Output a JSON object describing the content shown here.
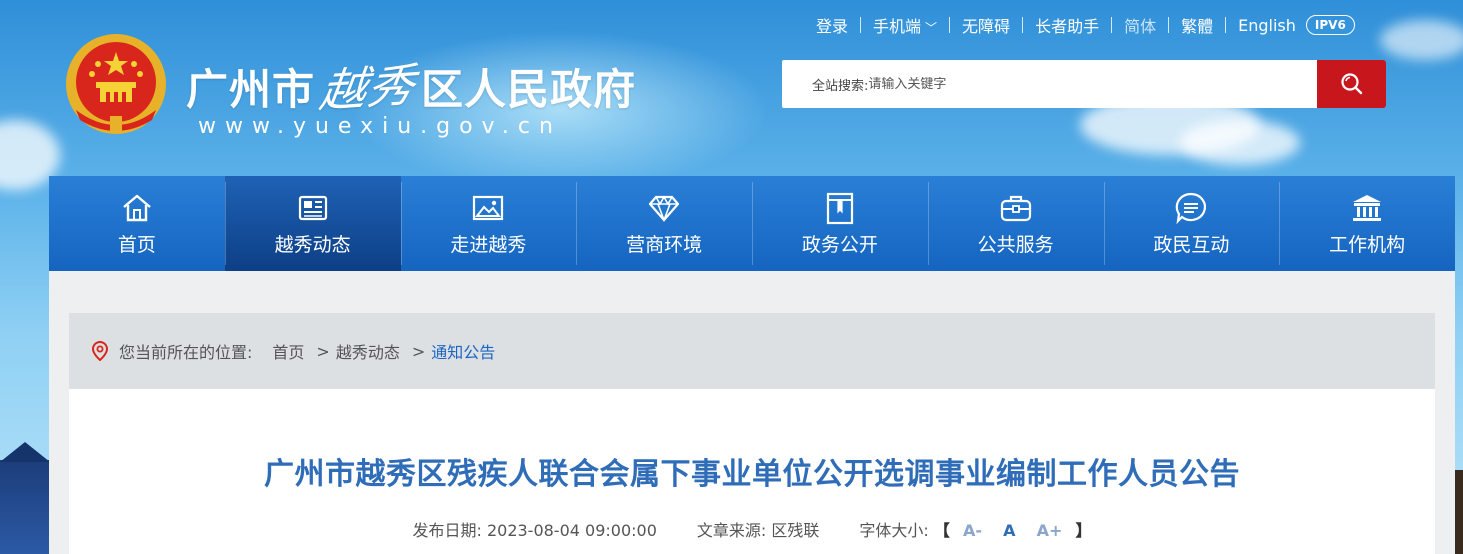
{
  "header": {
    "site_title_pre": "广州市",
    "site_title_callig": "越秀",
    "site_title_post": "区人民政府",
    "site_url": "www.yuexiu.gov.cn"
  },
  "topnav": {
    "login": "登录",
    "mobile": "手机端",
    "accessible": "无障碍",
    "elder": "长者助手",
    "simplified": "简体",
    "traditional": "繁體",
    "english": "English",
    "ipv6": "IPV6"
  },
  "search": {
    "label": "全站搜索:",
    "placeholder": "请输入关键字"
  },
  "mainnav": {
    "items": [
      {
        "label": "首页",
        "icon": "home-icon"
      },
      {
        "label": "越秀动态",
        "icon": "newspaper-icon"
      },
      {
        "label": "走进越秀",
        "icon": "picture-icon"
      },
      {
        "label": "营商环境",
        "icon": "diamond-icon"
      },
      {
        "label": "政务公开",
        "icon": "folder-icon"
      },
      {
        "label": "公共服务",
        "icon": "briefcase-icon"
      },
      {
        "label": "政民互动",
        "icon": "chat-icon"
      },
      {
        "label": "工作机构",
        "icon": "building-icon"
      }
    ],
    "active_index": 1
  },
  "breadcrumb": {
    "label": "您当前所在的位置:",
    "items": [
      "首页",
      "越秀动态",
      "通知公告"
    ],
    "separator": ">"
  },
  "article": {
    "title": "广州市越秀区残疾人联合会属下事业单位公开选调事业编制工作人员公告",
    "date_label": "发布日期:",
    "date": "2023-08-04 09:00:00",
    "source_label": "文章来源:",
    "source": "区残联",
    "font_label": "字体大小:",
    "font_open": "【",
    "font_small": "A-",
    "font_normal": "A",
    "font_large": "A+",
    "font_close": "】"
  },
  "colors": {
    "nav_blue": "#1565c0",
    "search_red": "#c8161d",
    "title_blue": "#2f6db8"
  }
}
